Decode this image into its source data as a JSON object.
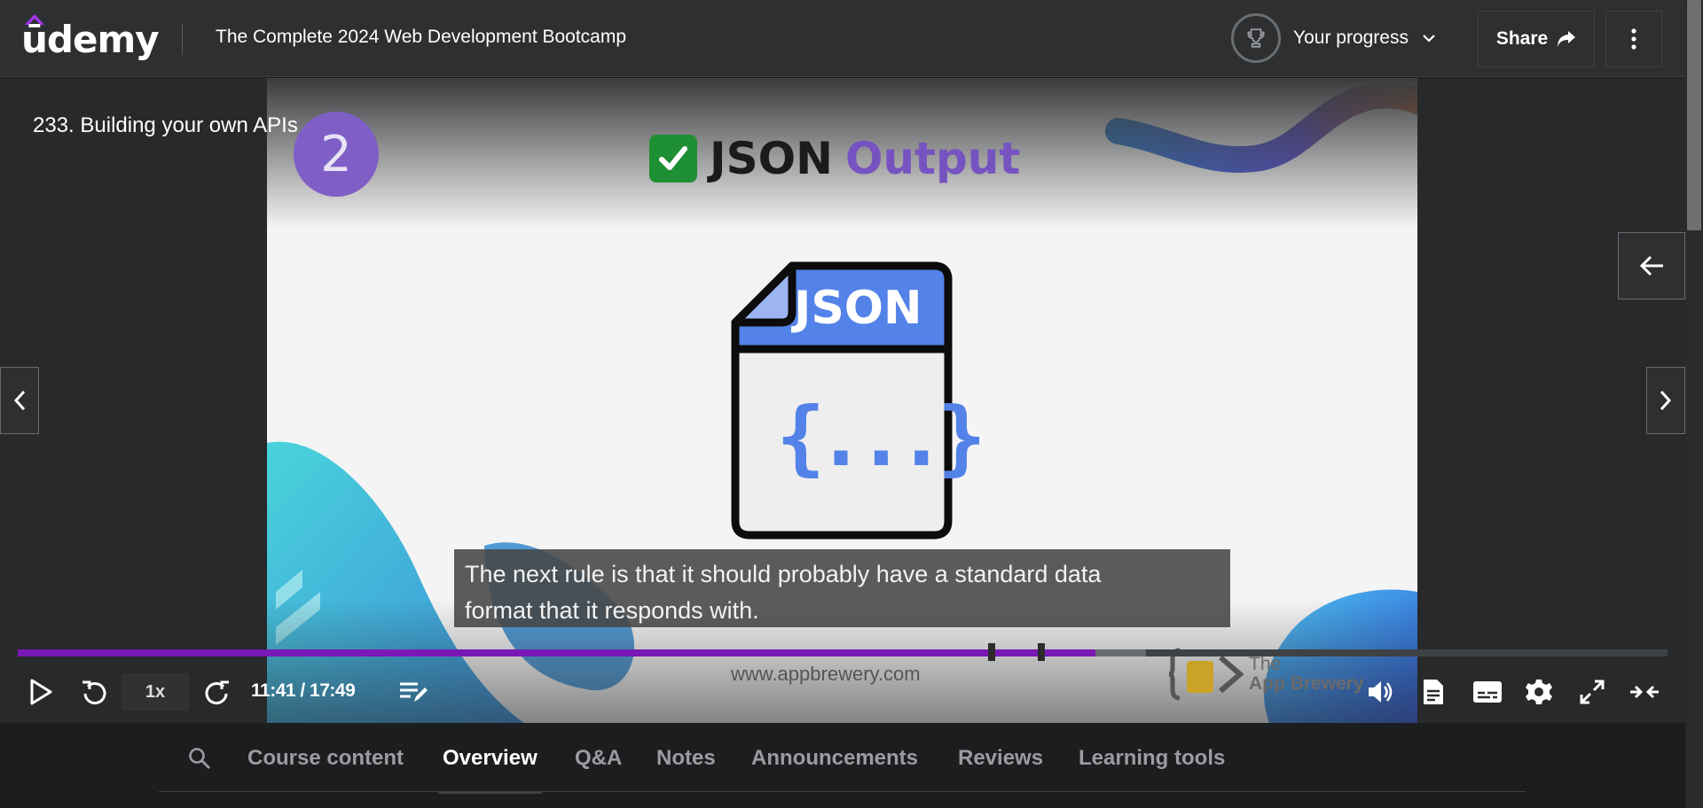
{
  "header": {
    "logo_text": "ūdemy",
    "course_title": "The Complete 2024 Web Development Bootcamp",
    "progress_label": "Your progress",
    "share_label": "Share"
  },
  "player": {
    "lesson_title": "233. Building your own APIs",
    "slide": {
      "badge_number": "2",
      "title_part1": "JSON",
      "title_part2": "Output",
      "doc_label": "JSON",
      "doc_body": "{...}",
      "site_url": "www.appbrewery.com",
      "brand_line1": "The",
      "brand_line2": "App Brewery"
    },
    "caption_line1": "The next rule is that it should probably have a standard data",
    "caption_line2": "format that it responds with.",
    "speed": "1x",
    "time": "11:41 / 17:49",
    "progress_fraction": 0.653,
    "buffered_fraction": 0.684,
    "colors": {
      "progress": "#7a18b6",
      "badge": "#7f5fc6",
      "json_blue": "#5382e8"
    }
  },
  "tabs": {
    "items": [
      {
        "label": "Course content",
        "active": false
      },
      {
        "label": "Overview",
        "active": true
      },
      {
        "label": "Q&A",
        "active": false
      },
      {
        "label": "Notes",
        "active": false
      },
      {
        "label": "Announcements",
        "active": false
      },
      {
        "label": "Reviews",
        "active": false
      },
      {
        "label": "Learning tools",
        "active": false
      }
    ]
  }
}
